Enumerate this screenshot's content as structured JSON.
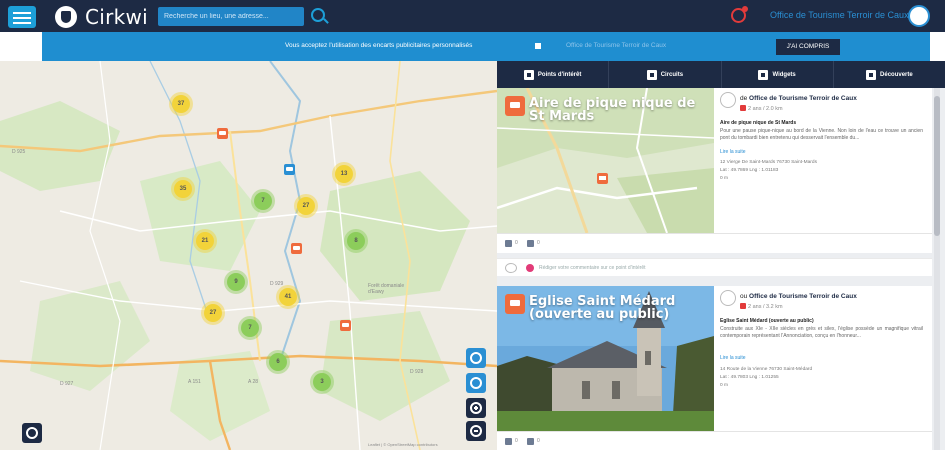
{
  "header": {
    "logo_text": "Cirkwi",
    "search_placeholder": "Recherche un lieu, une adresse...",
    "user_name": "Office de Tourisme Terroir de Caux"
  },
  "cookie_banner": {
    "text": "Vous acceptez l'utilisation des encarts publicitaires personnalisés",
    "faded_text": "Office de Tourisme Terroir de Caux",
    "accept_label": "J'AI COMPRIS"
  },
  "tabs": [
    {
      "label": "Points d'intérêt",
      "icon": "poi-icon"
    },
    {
      "label": "Circuits",
      "icon": "circuit-icon"
    },
    {
      "label": "Widgets",
      "icon": "widget-icon"
    },
    {
      "label": "Découverte",
      "icon": "discover-icon"
    }
  ],
  "map": {
    "clusters": [
      {
        "count": "37",
        "color": "yellow"
      },
      {
        "count": "35",
        "color": "yellow"
      },
      {
        "count": "13",
        "color": "yellow"
      },
      {
        "count": "7",
        "color": "green"
      },
      {
        "count": "27",
        "color": "yellow"
      },
      {
        "count": "21",
        "color": "yellow"
      },
      {
        "count": "8",
        "color": "green"
      },
      {
        "count": "9",
        "color": "green"
      },
      {
        "count": "41",
        "color": "yellow"
      },
      {
        "count": "27",
        "color": "yellow"
      },
      {
        "count": "7",
        "color": "green"
      },
      {
        "count": "6",
        "color": "green"
      },
      {
        "count": "3",
        "color": "green"
      }
    ],
    "labels": [
      "D 925",
      "Forêt domaniale d'Eawy",
      "D 929",
      "A 151",
      "A 28",
      "D 928",
      "D 927"
    ],
    "credit": "Leaflet | © OpenStreetMap contributors"
  },
  "cards": [
    {
      "title": "Aire de pique nique de St Mards",
      "author_prefix": "de",
      "author": "Office de Tourisme Terroir de Caux",
      "meta": "2 ans / 2.0 km",
      "info_title": "Aire de pique nique de St Mards",
      "description": "Pour une pause pique-nique au bord de la Vienne. Non loin de l'eau ce trouve un ancien pont du tombardi bien entretenu qui desservait l'ensemble du...",
      "read_more": "Lire la suite",
      "address": "12 Vierge De Saint-Mards 76730 Saint-Mards",
      "coords": "Lat : 49.7869 Lng : 1.01183",
      "altitude": "0 m",
      "likes": "0",
      "comments": "0"
    },
    {
      "title": "Eglise Saint Médard (ouverte au public)",
      "author_prefix": "ou",
      "author": "Office de Tourisme Terroir de Caux",
      "meta": "2 ans / 3.2 km",
      "info_title": "Eglise Saint Médard (ouverte au public)",
      "description": "Construite aux XIe - XIIe siècles en grès et silex, l'église possède un magnifique vitrail contemporain représentant l'Annonciation, conçu en l'honneur...",
      "read_more": "Lire la suite",
      "address": "14 Route de la Vienne 76730 Saint-Médard",
      "coords": "Lat : 49.7803 Lng : 1.01255",
      "altitude": "0 m",
      "likes": "0",
      "comments": "0"
    }
  ],
  "comment_placeholder": "Rédiger votre commentaire sur ce point d'intérêt"
}
